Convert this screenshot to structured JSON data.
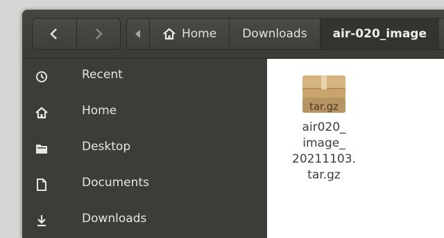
{
  "navigation": {
    "back_icon": "chevron-left-icon",
    "forward_icon": "chevron-right-icon"
  },
  "path_bar": {
    "overflow_icon": "caret-left-icon",
    "segments": [
      {
        "label": "Home",
        "icon": "home-icon"
      },
      {
        "label": "Downloads"
      },
      {
        "label": "air-020_image"
      }
    ]
  },
  "sidebar": {
    "items": [
      {
        "label": "Recent",
        "icon": "clock-icon"
      },
      {
        "label": "Home",
        "icon": "home-icon"
      },
      {
        "label": "Desktop",
        "icon": "folder-icon"
      },
      {
        "label": "Documents",
        "icon": "document-icon"
      },
      {
        "label": "Downloads",
        "icon": "download-icon"
      }
    ]
  },
  "files": [
    {
      "icon": "archive-icon",
      "icon_label": "tar.gz",
      "name_lines": [
        "air020_",
        "image_",
        "20211103.",
        "tar.gz"
      ]
    }
  ],
  "colors": {
    "sidebar_bg": "#3d3c37",
    "content_bg": "#ffffff",
    "archive_box": "#c8a26c"
  }
}
